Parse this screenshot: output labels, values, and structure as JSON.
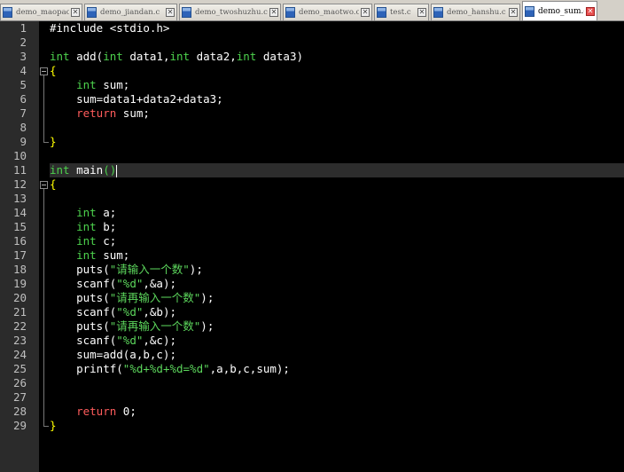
{
  "colors": {
    "keyword": "#4dd24d",
    "return_kw": "#ff5c5c",
    "string": "#5cd65c",
    "text": "#ffffff",
    "brace": "#ffff00",
    "paren_match": "#4dd24d",
    "number": "#ffffff"
  },
  "tabs": [
    {
      "label": "demo_maopao.c",
      "active": false
    },
    {
      "label": "demo_jiandan.c",
      "active": false
    },
    {
      "label": "demo_twoshuzhu.c",
      "active": false
    },
    {
      "label": "demo_maotwo.c",
      "active": false
    },
    {
      "label": "test.c",
      "active": false
    },
    {
      "label": "demo_hanshu.c",
      "active": false
    },
    {
      "label": "demo_sum.c",
      "active": true
    }
  ],
  "code": [
    [
      {
        "t": "#include <stdio.h>",
        "c": "text"
      }
    ],
    [],
    [
      {
        "t": "int",
        "c": "keyword"
      },
      {
        "t": " add(",
        "c": "text"
      },
      {
        "t": "int",
        "c": "keyword"
      },
      {
        "t": " data1,",
        "c": "text"
      },
      {
        "t": "int",
        "c": "keyword"
      },
      {
        "t": " data2,",
        "c": "text"
      },
      {
        "t": "int",
        "c": "keyword"
      },
      {
        "t": " data3)",
        "c": "text"
      }
    ],
    [
      {
        "t": "{",
        "c": "brace"
      }
    ],
    [
      {
        "t": "    ",
        "c": "text"
      },
      {
        "t": "int",
        "c": "keyword"
      },
      {
        "t": " sum;",
        "c": "text"
      }
    ],
    [
      {
        "t": "    sum=data1+data2+data3;",
        "c": "text"
      }
    ],
    [
      {
        "t": "    ",
        "c": "text"
      },
      {
        "t": "return",
        "c": "return_kw"
      },
      {
        "t": " sum;",
        "c": "text"
      }
    ],
    [],
    [
      {
        "t": "}",
        "c": "brace"
      }
    ],
    [],
    [
      {
        "t": "int",
        "c": "keyword"
      },
      {
        "t": " main",
        "c": "text"
      },
      {
        "t": "()",
        "c": "paren_match"
      }
    ],
    [
      {
        "t": "{",
        "c": "brace"
      }
    ],
    [],
    [
      {
        "t": "    ",
        "c": "text"
      },
      {
        "t": "int",
        "c": "keyword"
      },
      {
        "t": " a;",
        "c": "text"
      }
    ],
    [
      {
        "t": "    ",
        "c": "text"
      },
      {
        "t": "int",
        "c": "keyword"
      },
      {
        "t": " b;",
        "c": "text"
      }
    ],
    [
      {
        "t": "    ",
        "c": "text"
      },
      {
        "t": "int",
        "c": "keyword"
      },
      {
        "t": " c;",
        "c": "text"
      }
    ],
    [
      {
        "t": "    ",
        "c": "text"
      },
      {
        "t": "int",
        "c": "keyword"
      },
      {
        "t": " sum;",
        "c": "text"
      }
    ],
    [
      {
        "t": "    puts(",
        "c": "text"
      },
      {
        "t": "\"请输入一个数\"",
        "c": "string"
      },
      {
        "t": ");",
        "c": "text"
      }
    ],
    [
      {
        "t": "    scanf(",
        "c": "text"
      },
      {
        "t": "\"%d\"",
        "c": "string"
      },
      {
        "t": ",&a);",
        "c": "text"
      }
    ],
    [
      {
        "t": "    puts(",
        "c": "text"
      },
      {
        "t": "\"请再输入一个数\"",
        "c": "string"
      },
      {
        "t": ");",
        "c": "text"
      }
    ],
    [
      {
        "t": "    scanf(",
        "c": "text"
      },
      {
        "t": "\"%d\"",
        "c": "string"
      },
      {
        "t": ",&b);",
        "c": "text"
      }
    ],
    [
      {
        "t": "    puts(",
        "c": "text"
      },
      {
        "t": "\"请再输入一个数\"",
        "c": "string"
      },
      {
        "t": ");",
        "c": "text"
      }
    ],
    [
      {
        "t": "    scanf(",
        "c": "text"
      },
      {
        "t": "\"%d\"",
        "c": "string"
      },
      {
        "t": ",&c);",
        "c": "text"
      }
    ],
    [
      {
        "t": "    sum=add(a,b,c);",
        "c": "text"
      }
    ],
    [
      {
        "t": "    printf(",
        "c": "text"
      },
      {
        "t": "\"%d+%d+%d=%d\"",
        "c": "string"
      },
      {
        "t": ",a,b,c,sum);",
        "c": "text"
      }
    ],
    [],
    [],
    [
      {
        "t": "    ",
        "c": "text"
      },
      {
        "t": "return",
        "c": "return_kw"
      },
      {
        "t": " 0;",
        "c": "text"
      }
    ],
    [
      {
        "t": "}",
        "c": "brace"
      }
    ]
  ],
  "line_numbers": [
    "1",
    "2",
    "3",
    "4",
    "5",
    "6",
    "7",
    "8",
    "9",
    "10",
    "11",
    "12",
    "13",
    "14",
    "15",
    "16",
    "17",
    "18",
    "19",
    "20",
    "21",
    "22",
    "23",
    "24",
    "25",
    "26",
    "27",
    "28",
    "29"
  ],
  "caret_line": 11,
  "close_glyph": "✕"
}
